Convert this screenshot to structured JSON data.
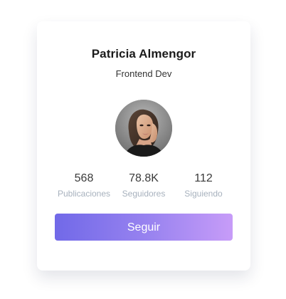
{
  "profile": {
    "name": "Patricia Almengor",
    "role": "Frontend Dev"
  },
  "stats": [
    {
      "value": "568",
      "label": "Publicaciones"
    },
    {
      "value": "78.8K",
      "label": "Seguidores"
    },
    {
      "value": "112",
      "label": "Siguiendo"
    }
  ],
  "actions": {
    "follow_label": "Seguir"
  },
  "icons": {
    "avatar": "avatar-photo"
  },
  "colors": {
    "button_gradient_start": "#7169e8",
    "button_gradient_end": "#c79cf8",
    "label_color": "#a7b1bd"
  }
}
